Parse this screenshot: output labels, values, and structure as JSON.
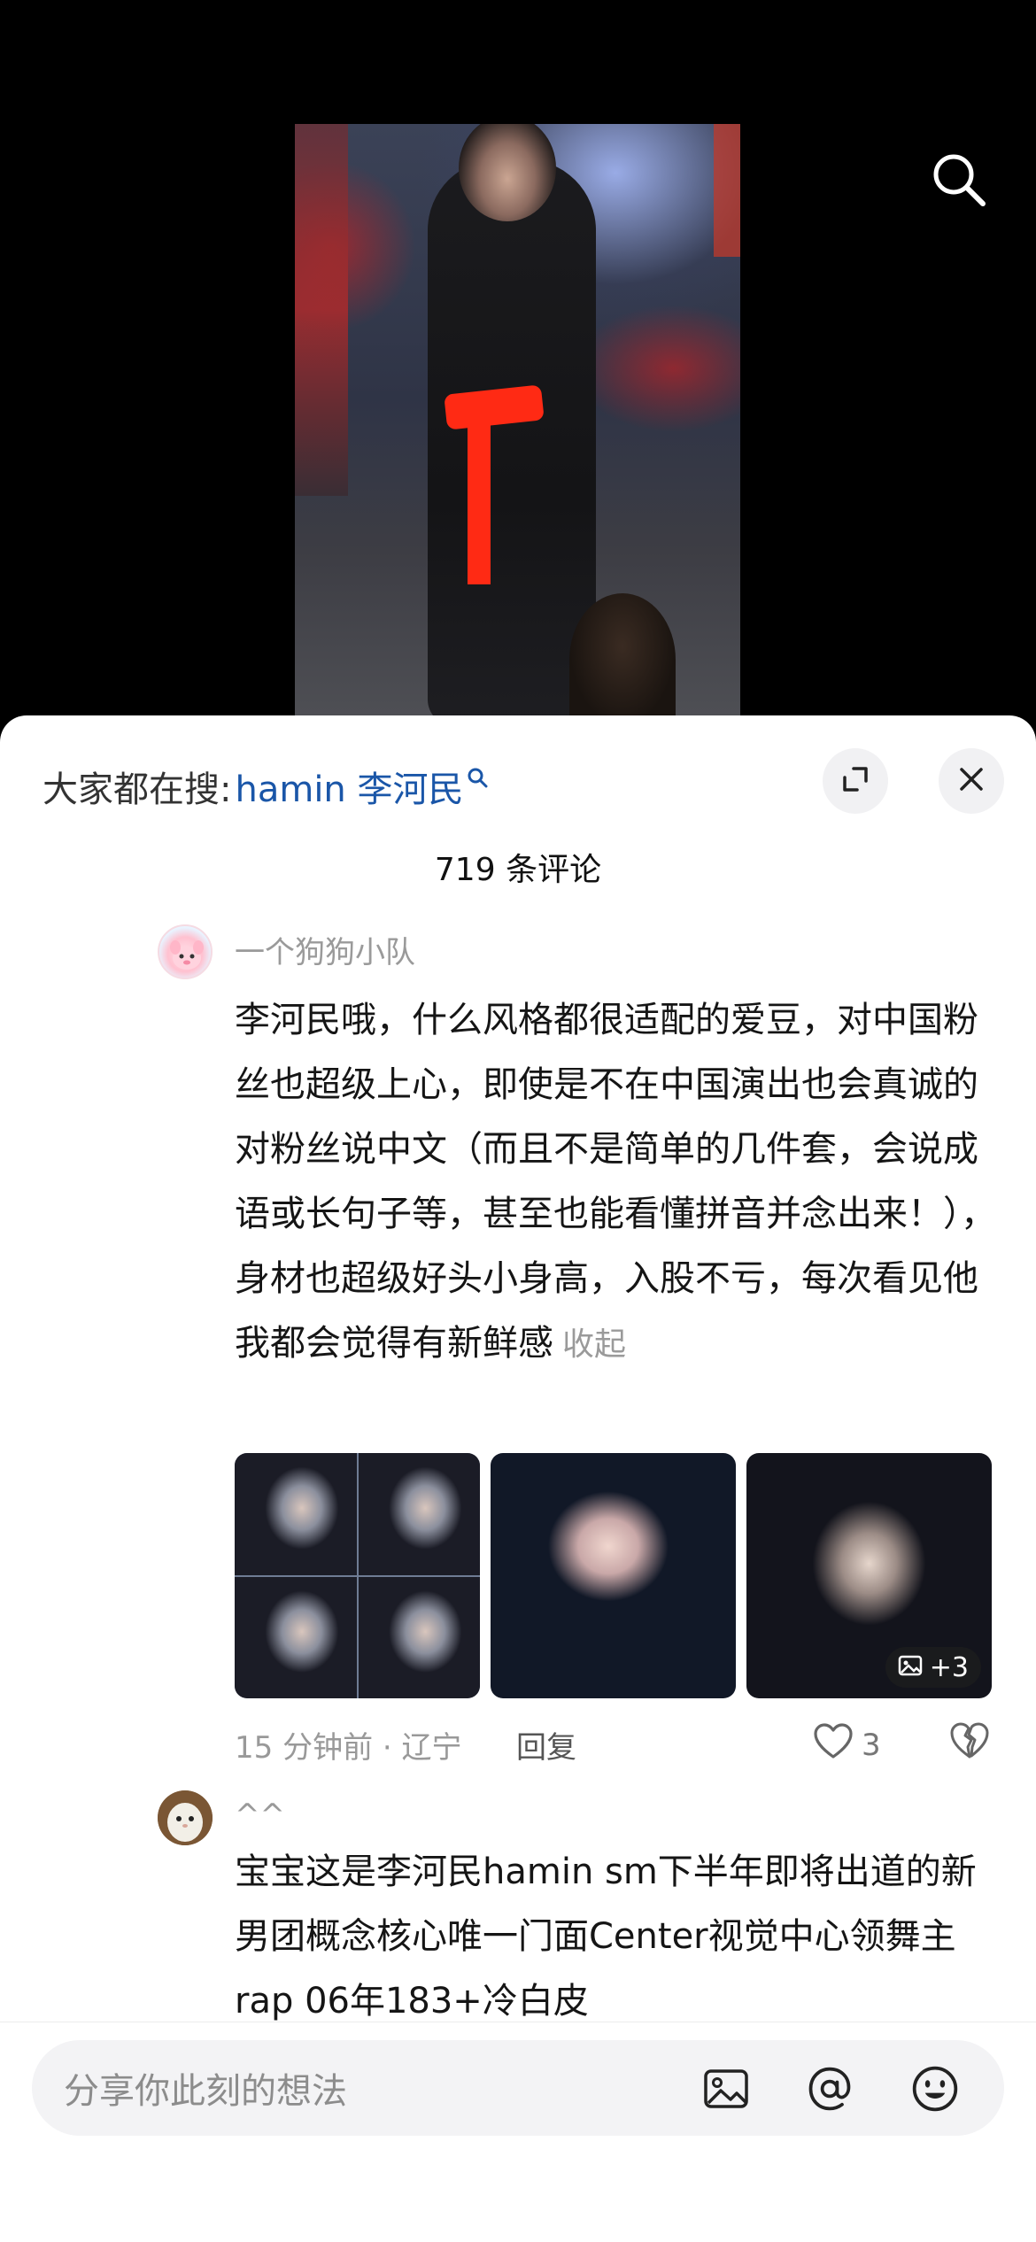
{
  "trending": {
    "prefix": "大家都在搜:",
    "term": "hamin 李河民",
    "search_glyph": "⚲"
  },
  "comments_header": {
    "count_label": "719 条评论"
  },
  "comments": [
    {
      "username": "一个狗狗小队",
      "text": "李河民哦，什么风格都很适配的爱豆，对中国粉丝也超级上心，即使是不在中国演出也会真诚的对粉丝说中文（而且不是简单的几件套，会说成语或长句子等，甚至也能看懂拼音并念出来！），身材也超级好头小身高，入股不亏，每次看见他我都会觉得有新鲜感",
      "collapse_label": "收起",
      "more_images_badge": "+3",
      "time_location": "15 分钟前 · 辽宁",
      "reply_label": "回复",
      "like_count": "3"
    },
    {
      "username": "^^",
      "text": "宝宝这是李河民hamin sm下半年即将出道的新男团概念核心唯一门面Center视觉中心领舞主rap 06年183+冷白皮"
    }
  ],
  "input_bar": {
    "placeholder": "分享你此刻的想法"
  },
  "icons": {
    "top_right": "search-icon",
    "expand": "expand-icon",
    "close": "close-icon",
    "like": "heart-icon",
    "dislike": "broken-heart-icon",
    "image": "image-icon",
    "mention": "at-icon",
    "emoji": "emoji-icon"
  },
  "colors": {
    "trend_term": "#1a56a8",
    "background_video": "#000000",
    "sheet": "#ffffff"
  }
}
